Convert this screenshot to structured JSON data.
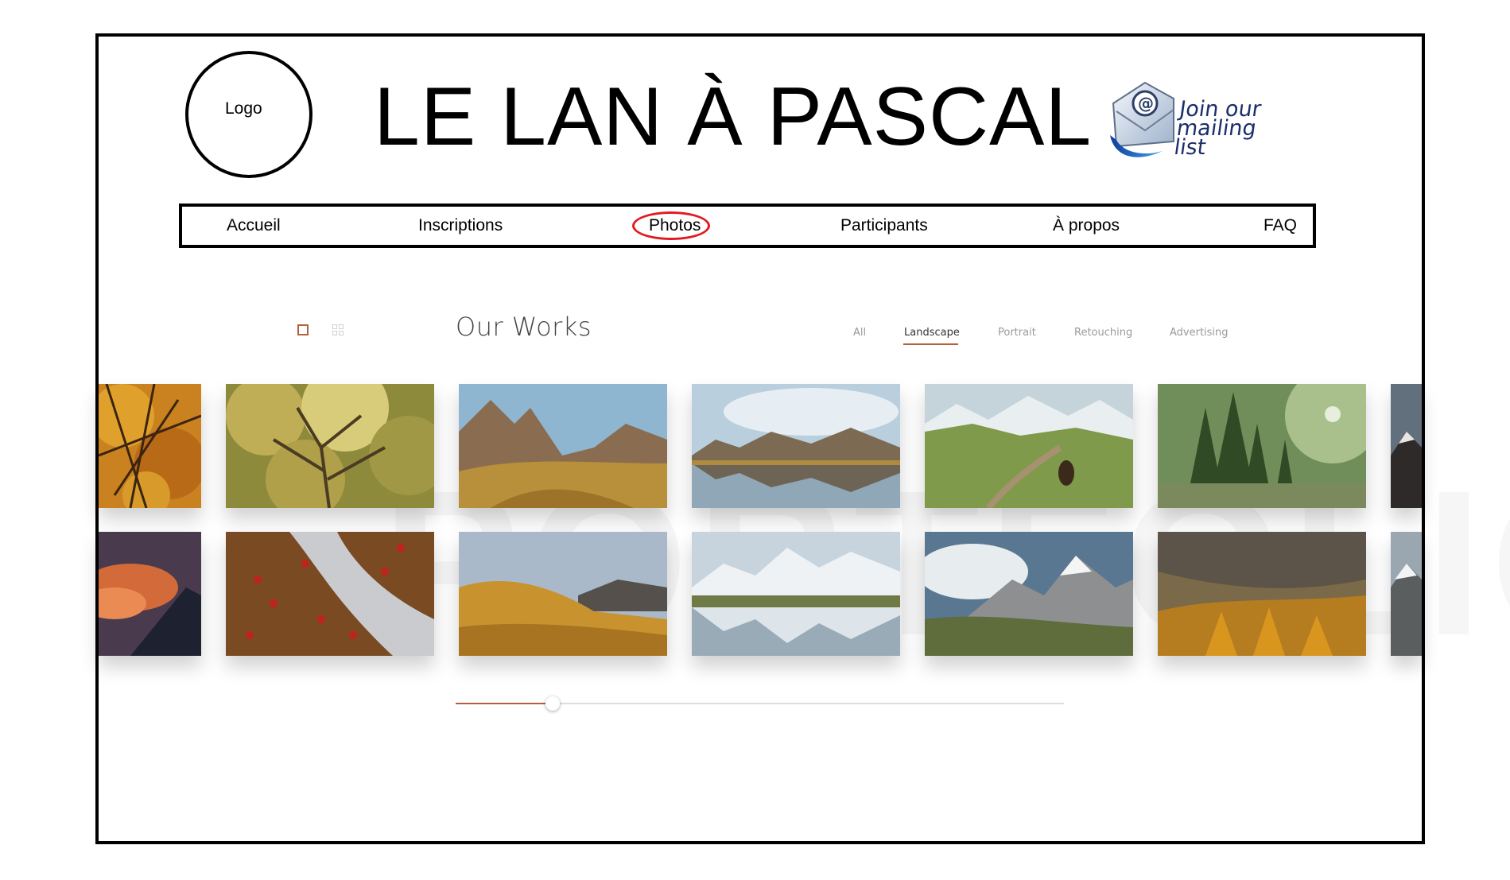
{
  "header": {
    "logo_label": "Logo",
    "site_title": "LE LAN À PASCAL",
    "mailing_line1": "Join our",
    "mailing_line2": "mailing list",
    "mailing_icon": "at-envelope-icon"
  },
  "nav": {
    "items": [
      {
        "label": "Accueil"
      },
      {
        "label": "Inscriptions"
      },
      {
        "label": "Photos"
      },
      {
        "label": "Participants"
      },
      {
        "label": "À propos"
      },
      {
        "label": "FAQ"
      }
    ],
    "highlighted": "Photos",
    "highlight_color": "#e11b22"
  },
  "gallery": {
    "title": "Our Works",
    "view_icons": [
      "single-view-icon",
      "grid-view-icon"
    ],
    "filters": [
      {
        "label": "All"
      },
      {
        "label": "Landscape"
      },
      {
        "label": "Portrait"
      },
      {
        "label": "Retouching"
      },
      {
        "label": "Advertising"
      }
    ],
    "active_filter": "Landscape",
    "accent_color": "#b5603b",
    "row1": [
      "autumn-branches",
      "yellow-tree",
      "mountain-valley",
      "mountain-lake-reflection",
      "cow-mountain-path",
      "forest-lake",
      "snowy-peak-partial"
    ],
    "row2": [
      "sunset-mountain",
      "red-berries-stream",
      "golden-hills",
      "snowy-range-reflection",
      "cloudy-peaks",
      "autumn-forest-slope",
      "snowy-peak-partial"
    ],
    "slider_position": 0.16
  }
}
